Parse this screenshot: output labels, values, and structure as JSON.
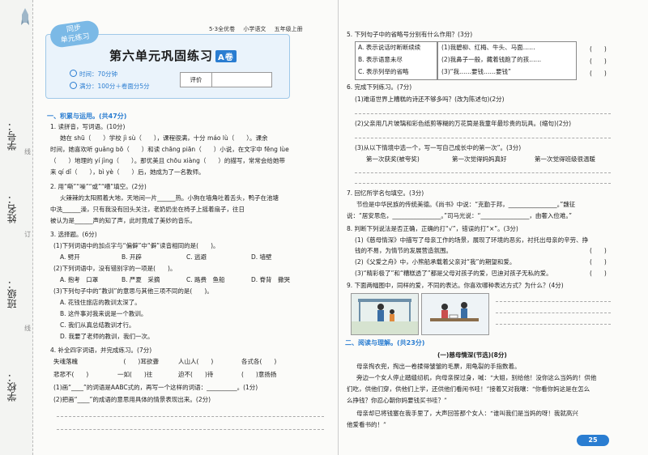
{
  "gutter": {
    "school": "学校：",
    "class": "班级：",
    "name": "姓名：",
    "number": "学号：",
    "line": "线",
    "ding": "订"
  },
  "header": {
    "tag": "5·3全优卷",
    "subject": "小学语文",
    "grade": "五年级上册",
    "badge_line1": "同步",
    "badge_line2": "单元练习",
    "title": "第六单元巩固练习",
    "ab": "A卷",
    "time": "时间：70分钟",
    "score": "满分：100分＋卷面分5分",
    "eval": "评价"
  },
  "left": {
    "sec1": "一、积累与运用。(共47分)",
    "q1": "1. 读拼音，写词语。(10分)",
    "q1_l1": "她在 shū（　　）学校 jì sù（　　），课程很满，十分 máo lù（　　）。课余",
    "q1_l2": "时间，她喜欢听 guǎng bō（　　）和读 chāng piān（　　）小说，在文字中 fēng lùe",
    "q1_l3": "（　　）地理的 yí jìng（　　）。那优美且 chōu xiàng（　　）的描写，常常会给她带",
    "q1_l4": "来 qí dǐ（　　），bì yè（　　）后，她成为了一名教师。",
    "q2": "2. 用“嘶”“噪”“或”“嘈”填空。(2分)",
    "q2_l1": "火辣辣的太阳照着大地，天地间一片______热。小狗在墙角吐着舌头，鸭子在池塘",
    "q2_l2": "中洗______澡，只有我没有回头关注，老奶奶坐在椅子上摇着扇子，往日",
    "q2_l3": "被认为是______声的知了声，此时竟成了美妙的音乐。",
    "q3": "3. 选择题。(6分)",
    "q3_1": "(1)下列词语中的加点字与“偏僻”中“僻”读音相同的是(　　)。",
    "q3_1o": [
      "A. 劈开",
      "B. 开辟",
      "C. 逃避",
      "D. 墙壁"
    ],
    "q3_2": "(2)下列词语中，没有错别字的一项是(　　)。",
    "q3_2o": [
      "A. 抱考　口罩",
      "B. 严夏　采摘",
      "C. 路费　鱼船",
      "D. 脊背　撒哭"
    ],
    "q3_3": "(3)下列句子中的“教训”的意思与其他三项不同的是(　　)。",
    "q3_3o": [
      "A. 花钱住旅店的教训太深了。",
      "B. 这件事对我来说是一个教训。",
      "C. 我们从真总结教训才行。",
      "D. 我要了老师的教训，我们一次。"
    ],
    "q4": "4. 补全四字词语，并完成练习。(7分)",
    "q4_r1": [
      "失魂落魄",
      "　　　(　　)耳欲聋",
      "人山人(　　)",
      "各式各(　　)"
    ],
    "q4_r2": [
      "悲悲不(　　)",
      "一如(　　)往",
      "迫不(　　)待",
      "(　　)意扬扬"
    ],
    "q4_s1": "(1)画“____”的词语是AABC式的，再写一个这样的词语：__________。(1分)",
    "q4_s2": "(2)把画“____”的成语的意思用具体的情景表现出来。(2分)"
  },
  "right": {
    "q5": "5. 下列句子中的省略号分别有什么作用？(3分)",
    "q5_l": [
      "A. 表示说话时断断续续",
      "B. 表示语意未尽",
      "C. 表示列举的省略"
    ],
    "q5_r": [
      "(1)我碧柳、红梅、牛头、马面……",
      "(2)我鼻子一般，藏着钱跑了的孩……",
      "(3)“我……要钱……要钱”"
    ],
    "q6": "6. 完成下列练习。(7分)",
    "q6_1": "(1)难道世界上糟糕的诗还不够多吗？(改为陈述句)(2分)",
    "q6_2": "(2)父亲用几片玻璃和彩色纸剪等糊的万花筒是我童年最珍贵的玩具。(缩句)(2分)",
    "q6_3": "(3)从以下情境中选一个，写一写自己成长中的第一次”。(3分)",
    "q6_3o": [
      "第一次获奖(被夸奖)",
      "第一次觉得妈妈真好",
      "第一次觉得班级很温暖"
    ],
    "q7": "7. 回忆所学名句填空。(3分)",
    "q7_l1": "节俭是中华民族的传统美德。《尚书》中说：“克勤于邦，________________。”魏征",
    "q7_l2": "说：“居安思危，________________。”司马光说：“________________，由奢入俭难。”",
    "q8": "8. 判断下列说法是否正确，正确的打“√”，错误的打“×”。(3分)",
    "q8_1": "(1)《慈母情深》中描写了母亲工作的场景，展现了环境的恶劣，衬托出母亲的辛劳、挣",
    "q8_1b": "钱的不易，为情节的发展营造氛围。",
    "q8_2": "(2)《父爱之舟》中，小熊船承载着父亲对“我”的期望和爱。",
    "q8_3": "(3)“精彩极了”和“糟糕透了”都是父母对孩子的爱，巴迪对孩子无私的爱。",
    "q9": "9. 下面两幅图中，同样的爱，不同的表达。你喜欢哪种表达方式？为什么？(4分)",
    "sec2": "二、阅读与理解。(共23分)",
    "passage_title": "(一)慈母情深(节选)(8分)",
    "p1": "母亲掏衣兜，掏出一卷揉得皱皱的毛票，用龟裂的手指数着。",
    "p2": "旁边一个女人停止踏缝纫机，向母亲探过身，喊：“大姐，别给他！没你这么当妈的！供他",
    "p3": "们吃，供他们穿，供他们上学，还供他们看闲书哇！”接着又对我嚷：“你看你妈这是在怎么",
    "p4": "么挣钱？你忍心朝你妈要钱买书哇？”",
    "p5": "母亲却已将钱塞在我手里了，大声回答那个女人：“谁叫我们是当妈的呀！我就高兴",
    "p6": "他爱看书的！”",
    "page_num": "25"
  }
}
